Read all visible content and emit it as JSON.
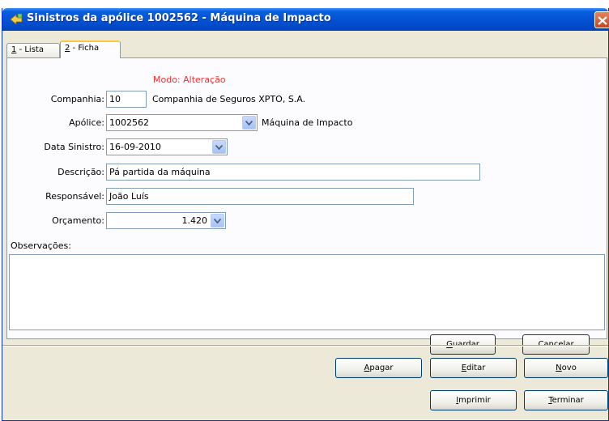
{
  "window": {
    "title": "Sinistros da apólice 1002562 - Máquina de Impacto"
  },
  "tabs": [
    {
      "prefix": "1",
      "label": " - Lista"
    },
    {
      "prefix": "2",
      "label": " - Ficha"
    }
  ],
  "form": {
    "mode": "Modo: Alteração",
    "companhia": {
      "label": "Companhia:",
      "value": "10",
      "name": "Companhia de Seguros XPTO, S.A."
    },
    "apolice": {
      "label": "Apólice:",
      "value": "1002562",
      "desc": "Máquina de Impacto"
    },
    "data_sinistro": {
      "label": "Data Sinistro:",
      "value": "16-09-2010"
    },
    "descricao": {
      "label": "Descrição:",
      "value": "Pá partida da máquina"
    },
    "responsavel": {
      "label": "Responsável:",
      "value": "João Luís"
    },
    "orcamento": {
      "label": "Orçamento:",
      "value": "1.420"
    },
    "observacoes": {
      "label": "Observações:",
      "value": ""
    }
  },
  "panel_buttons": {
    "guardar": {
      "access": "G",
      "rest": "uardar"
    },
    "cancelar": {
      "label": "Cancelar"
    }
  },
  "footer_buttons": {
    "apagar": {
      "access": "A",
      "rest": "pagar"
    },
    "editar": {
      "access": "E",
      "rest": "ditar"
    },
    "novo": {
      "access": "N",
      "rest": "ovo"
    },
    "imprimir": {
      "access": "I",
      "rest": "mprimir"
    },
    "terminar": {
      "access": "T",
      "rest": "erminar"
    }
  },
  "colors": {
    "titlebar": "#0453d4",
    "mode_text": "#ff2b2b",
    "field_border": "#7f9db9",
    "button_border": "#003c74"
  },
  "icons": {
    "title": "app-arrow-icon",
    "close": "close-icon",
    "dropdown": "chevron-down-icon"
  }
}
